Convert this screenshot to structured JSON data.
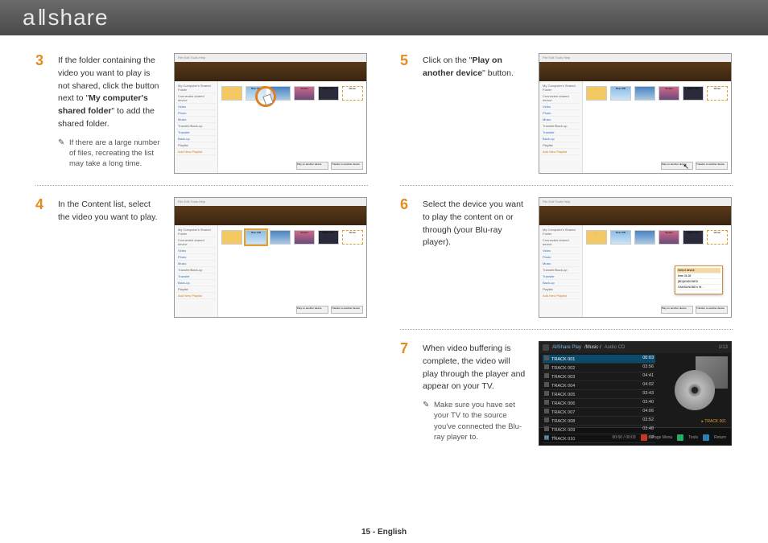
{
  "header": {
    "logo_pre": "a",
    "logo_post": "share"
  },
  "steps": {
    "s3": {
      "num": "3",
      "text_before": "If the folder containing the video you want to play is not shared, click the button next to \"",
      "bold": "My computer's shared folder",
      "text_after": "\" to add the shared folder.",
      "note": "If there are a large number of files, recreating the list may take a long time."
    },
    "s4": {
      "num": "4",
      "text": "In the Content list, select the video you want to play."
    },
    "s5": {
      "num": "5",
      "text_before": "Click on the \"",
      "bold": "Play on another device",
      "text_after": "\" button."
    },
    "s6": {
      "num": "6",
      "text": "Select the device you want to play the content on or through (your Blu-ray player)."
    },
    "s7": {
      "num": "7",
      "text": "When video buffering is complete, the video will play through the player and appear on your TV.",
      "note": "Make sure you have set your TV to the source you've connected the Blu-ray player to."
    }
  },
  "shot": {
    "menu": "File   Edit   Tools   Help",
    "side": {
      "shared": "My Computer's Shared Folder",
      "connected": "Connected shared device",
      "video": "Video",
      "photo": "Photo",
      "music": "Music",
      "transfer": "Transfer/Back-up",
      "t1": "Transfer",
      "t2": "Back-up",
      "playlist": "Playlist",
      "add": "Add New Playlist"
    },
    "thumbs": {
      "up": "..",
      "blue": "Blue WB",
      "sunset": "Sunset",
      "water": "Water Vibe",
      "winter": "Winter"
    },
    "btn1": "Play on another device",
    "btn2": "Transfer to another device",
    "popup": {
      "title": "Select device",
      "line1": "time 04:28",
      "line2": "[BD]UNSIGNED",
      "line3": "SAMSUNGBD's W…"
    }
  },
  "player": {
    "title": "AllShare Play",
    "sub": "/Music /",
    "src": "Audio CD",
    "count": "1/13",
    "tracks": [
      {
        "n": "TRACK 001",
        "t": "00:03"
      },
      {
        "n": "TRACK 002",
        "t": "03:56"
      },
      {
        "n": "TRACK 003",
        "t": "04:41"
      },
      {
        "n": "TRACK 004",
        "t": "04:02"
      },
      {
        "n": "TRACK 005",
        "t": "03:43"
      },
      {
        "n": "TRACK 006",
        "t": "03:40"
      },
      {
        "n": "TRACK 007",
        "t": "04:06"
      },
      {
        "n": "TRACK 008",
        "t": "03:52"
      },
      {
        "n": "TRACK 009",
        "t": "03:48"
      },
      {
        "n": "TRACK 010",
        "t": "04:00"
      }
    ],
    "now": "TRACK 001",
    "time": "00:00 / 00:03",
    "menu_page": "Page Menu",
    "menu_tools": "Tools",
    "menu_return": "Return"
  },
  "footer": "15 - English"
}
